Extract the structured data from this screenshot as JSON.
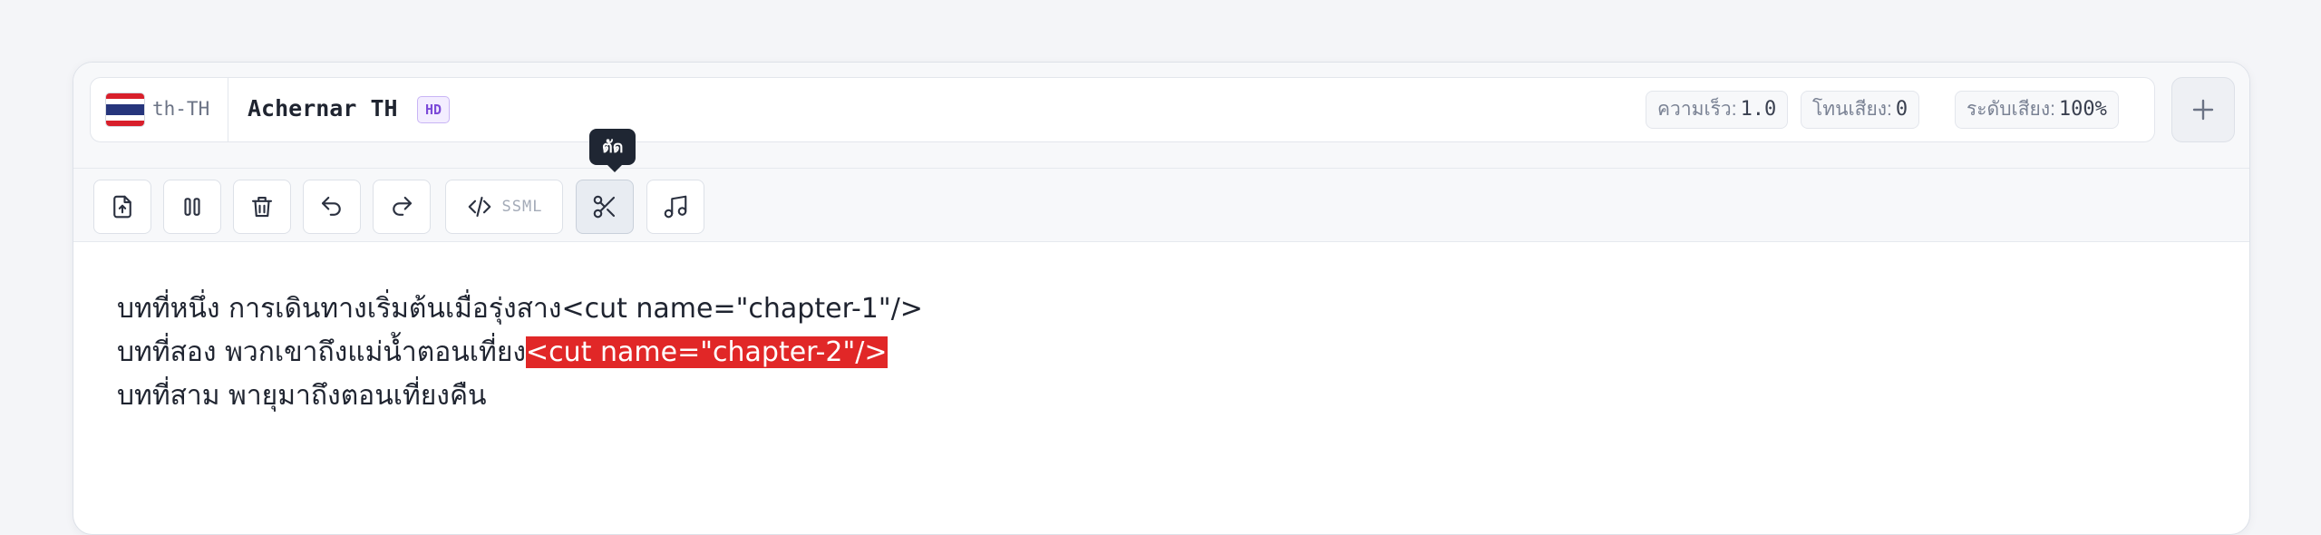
{
  "voice": {
    "language_code": "th-TH",
    "flag": "thailand-flag",
    "name": "Achernar TH",
    "quality_badge": "HD",
    "params": [
      {
        "label": "ความเร็ว:",
        "value": "1.0"
      },
      {
        "label": "โทนเสียง:",
        "value": "0"
      },
      {
        "label": "ระดับเสียง:",
        "value": "100%"
      }
    ]
  },
  "toolbar": {
    "buttons": [
      {
        "name": "upload-file-button",
        "icon": "file-upload-icon"
      },
      {
        "name": "pause-button",
        "icon": "pause-icon"
      },
      {
        "name": "delete-button",
        "icon": "trash-icon"
      },
      {
        "name": "undo-button",
        "icon": "undo-icon"
      },
      {
        "name": "redo-button",
        "icon": "redo-icon"
      },
      {
        "name": "ssml-button",
        "icon": "code-icon",
        "label": "SSML"
      },
      {
        "name": "cut-button",
        "icon": "scissors-icon",
        "active": true
      },
      {
        "name": "music-button",
        "icon": "music-note-icon"
      }
    ],
    "tooltip": "ตัด"
  },
  "editor": {
    "lines": [
      {
        "text": "บทที่หนึ่ง การเดินทางเริ่มต้นเมื่อรุ่งสาง",
        "tag": "<cut name=\"chapter-1\"/>",
        "tag_highlighted": false
      },
      {
        "text": "บทที่สอง พวกเขาถึงแม่น้ำตอนเที่ยง",
        "tag": "<cut name=\"chapter-2\"/>",
        "tag_highlighted": true
      },
      {
        "text": "บทที่สาม พายุมาถึงตอนเที่ยงคืน",
        "tag": "",
        "tag_highlighted": false
      }
    ]
  },
  "colors": {
    "highlight": "#e12727",
    "tooltip_bg": "#1f2633",
    "hd_badge": "#7c4ad8",
    "text": "#1f2430"
  }
}
